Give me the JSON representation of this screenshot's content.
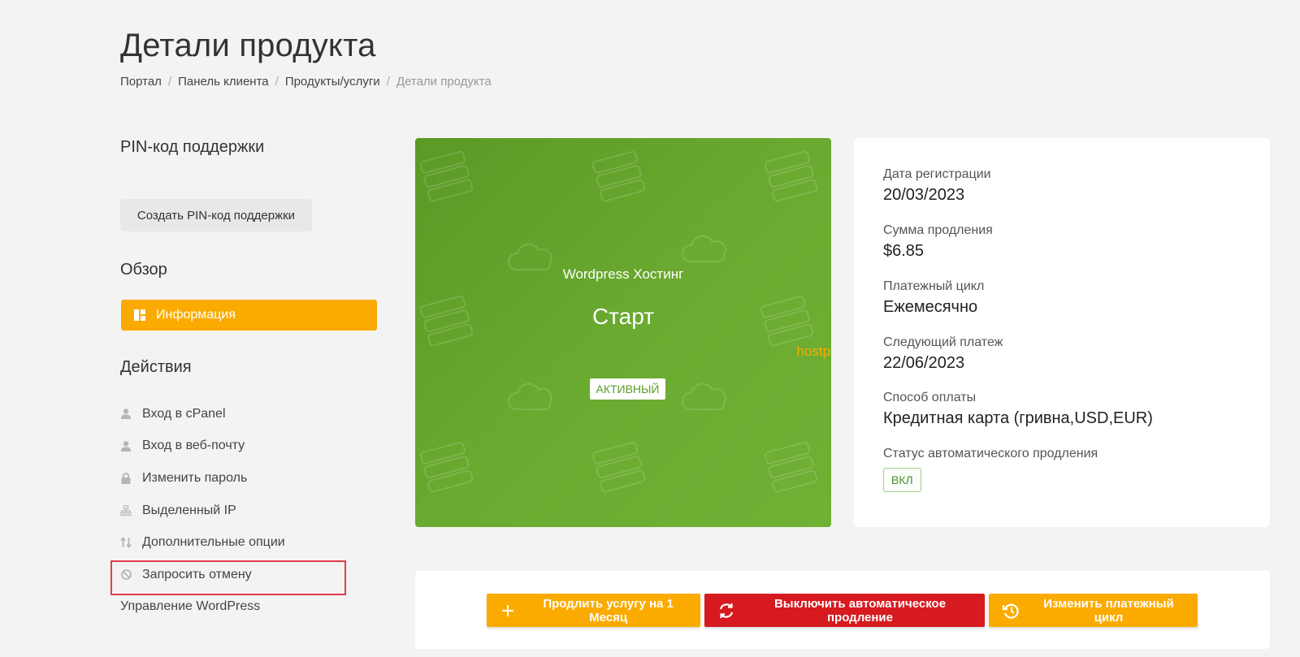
{
  "page": {
    "title": "Детали продукта",
    "breadcrumb": [
      "Портал",
      "Панель клиента",
      "Продукты/услуги",
      "Детали продукта"
    ]
  },
  "sidebar": {
    "pin_title": "PIN-код поддержки",
    "pin_button": "Создать PIN-код поддержки",
    "overview_title": "Обзор",
    "info_item": "Информация",
    "actions_title": "Действия",
    "actions": [
      {
        "label": "Вход в cPanel",
        "icon": "user-icon"
      },
      {
        "label": "Вход в веб-почту",
        "icon": "user-icon"
      },
      {
        "label": "Изменить пароль",
        "icon": "lock-icon"
      },
      {
        "label": "Выделенный IP",
        "icon": "network-icon"
      },
      {
        "label": "Дополнительные опции",
        "icon": "sort-arrows-icon"
      },
      {
        "label": "Запросить отмену",
        "icon": "ban-icon"
      },
      {
        "label": "Управление WordPress",
        "icon": ""
      }
    ],
    "highlight_color": "#e23c4c"
  },
  "product": {
    "type": "Wordpress Хостинг",
    "name": "Старт",
    "domain": "hostpro.fun",
    "status": "АКТИВНЫЙ",
    "bg_color": "#5f9e2a",
    "domain_color": "#fbab00"
  },
  "details": {
    "reg_label": "Дата регистрации",
    "reg_value": "20/03/2023",
    "renew_label": "Сумма продления",
    "renew_value": "$6.85",
    "cycle_label": "Платежный цикл",
    "cycle_value": "Ежемесячно",
    "next_label": "Следующий платеж",
    "next_value": "22/06/2023",
    "method_label": "Способ оплаты",
    "method_value": "Кредитная карта (гривна,USD,EUR)",
    "auto_label": "Статус автоматического продления",
    "auto_value": "ВКЛ"
  },
  "buttons": {
    "renew": "Продлить услугу на 1 Месяц",
    "auto_off": "Выключить автоматическое продление",
    "change_cycle": "Изменить платежный цикл"
  },
  "colors": {
    "accent": "#fbab00",
    "danger": "#d71a20"
  }
}
